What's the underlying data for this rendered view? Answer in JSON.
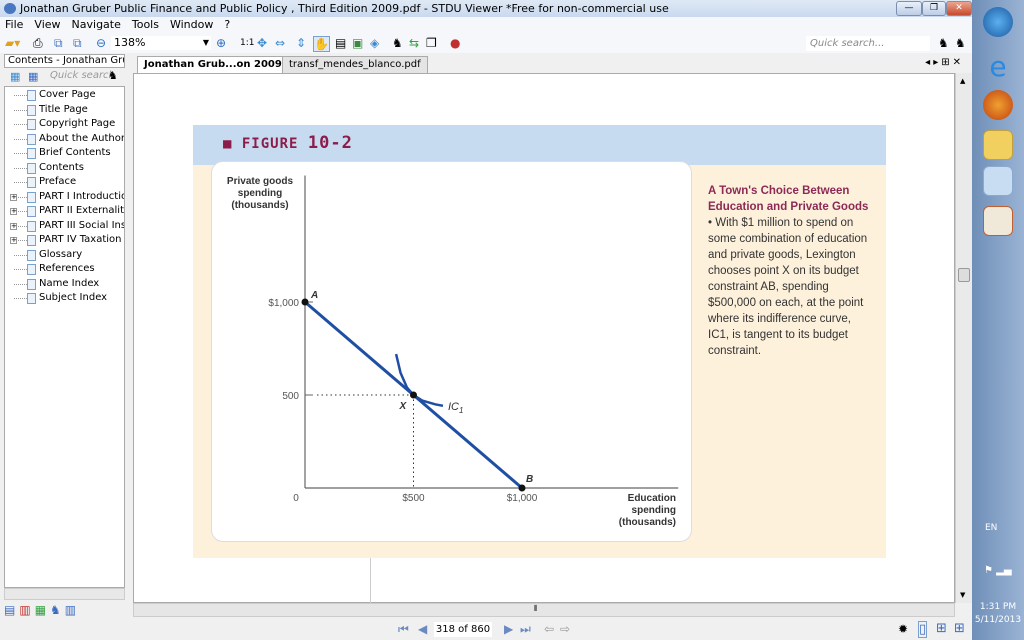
{
  "window": {
    "title": "Jonathan Gruber Public Finance and Public Policy , Third Edition    2009.pdf - STDU Viewer *Free for non-commercial use",
    "minimize": "—",
    "restore": "❐",
    "close": "✕"
  },
  "menu": [
    "File",
    "View",
    "Navigate",
    "Tools",
    "Window",
    "?"
  ],
  "toolbar": {
    "zoom": "138%",
    "quick_search_placeholder": "Quick search...",
    "one_to_one": "1:1"
  },
  "sidebar": {
    "title": "Contents - Jonathan Gruber",
    "quick_search_placeholder": "Quick search",
    "items": [
      {
        "label": "Cover Page",
        "expandable": false
      },
      {
        "label": "Title Page",
        "expandable": false
      },
      {
        "label": "Copyright Page",
        "expandable": false
      },
      {
        "label": "About the Author",
        "expandable": false
      },
      {
        "label": "Brief Contents",
        "expandable": false
      },
      {
        "label": "Contents",
        "expandable": false
      },
      {
        "label": "Preface",
        "expandable": false
      },
      {
        "label": "PART I Introduction",
        "expandable": true
      },
      {
        "label": "PART II Externalities",
        "expandable": true
      },
      {
        "label": "PART III Social Insur",
        "expandable": true
      },
      {
        "label": "PART IV Taxation in",
        "expandable": true
      },
      {
        "label": "Glossary",
        "expandable": false
      },
      {
        "label": "References",
        "expandable": false
      },
      {
        "label": "Name Index",
        "expandable": false
      },
      {
        "label": "Subject Index",
        "expandable": false
      }
    ]
  },
  "tabs": [
    {
      "label": "Jonathan Grub...on    2009.pdf",
      "active": true
    },
    {
      "label": "transf_mendes_blanco.pdf",
      "active": false
    }
  ],
  "status": {
    "page": "318 of 860"
  },
  "clock": {
    "lang": "EN",
    "time": "1:31 PM",
    "date": "5/11/2013"
  },
  "colors": {
    "accent": "#8c1d4a",
    "line": "#1f4fa3",
    "header_band": "#c7dbf0",
    "figure_bg": "#fdf1dc"
  },
  "figure": {
    "label": "FIGURE",
    "number": "10-2",
    "caption_title": "A Town's Choice Between Education and Private Goods",
    "caption_body": " • With $1 million to spend on some combination of education and private goods, Lexington chooses point X on its budget constraint AB, spending $500,000 on each, at the point where its indifference curve, IC1, is tangent to its budget constraint."
  },
  "chart_data": {
    "type": "line",
    "ylabel": "Private goods spending (thousands)",
    "xlabel": "Education spending (thousands)",
    "xlim": [
      0,
      1720
    ],
    "ylim": [
      0,
      1680
    ],
    "x_ticks": [
      {
        "value": 0,
        "label": "0"
      },
      {
        "value": 500,
        "label": "$500"
      },
      {
        "value": 1000,
        "label": "$1,000"
      }
    ],
    "y_ticks": [
      {
        "value": 500,
        "label": "500"
      },
      {
        "value": 1000,
        "label": "$1,000"
      }
    ],
    "series": [
      {
        "name": "AB",
        "points": [
          [
            0,
            1000
          ],
          [
            1000,
            0
          ]
        ]
      },
      {
        "name": "IC1",
        "points": [
          [
            420,
            720
          ],
          [
            440,
            620
          ],
          [
            470,
            540
          ],
          [
            500,
            500
          ],
          [
            540,
            470
          ],
          [
            600,
            450
          ],
          [
            636,
            442
          ]
        ]
      }
    ],
    "points": [
      {
        "label": "A",
        "x": 0,
        "y": 1000
      },
      {
        "label": "X",
        "x": 500,
        "y": 500
      },
      {
        "label": "B",
        "x": 1000,
        "y": 0
      }
    ],
    "grid": false
  }
}
